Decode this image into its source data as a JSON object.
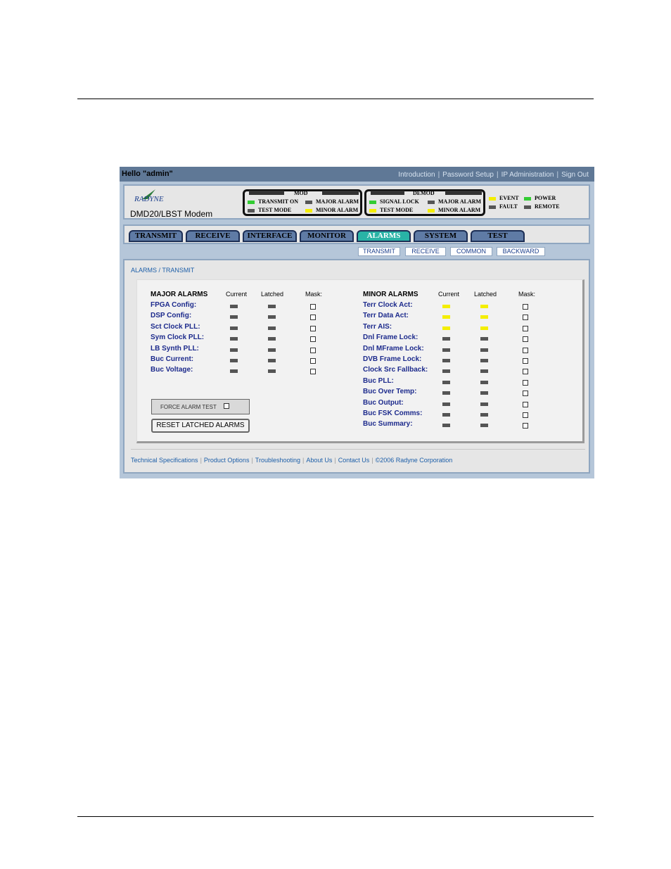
{
  "topbar": {
    "greeting": "Hello \"admin\"",
    "links": [
      "Introduction",
      "Password Setup",
      "IP Administration",
      "Sign Out"
    ]
  },
  "header": {
    "brand": "RADYNE",
    "model": "DMD20/LBST Modem",
    "mod": {
      "title": "MOD",
      "leds": [
        {
          "label": "TRANSMIT ON",
          "color": "#33cc33"
        },
        {
          "label": "TEST MODE",
          "color": "#555555"
        },
        {
          "label": "MAJOR ALARM",
          "color": "#555555"
        },
        {
          "label": "MINOR ALARM",
          "color": "#f4ee00"
        }
      ]
    },
    "demod": {
      "title": "DEMOD",
      "leds": [
        {
          "label": "SIGNAL LOCK",
          "color": "#33cc33"
        },
        {
          "label": "TEST MODE",
          "color": "#f4ee00"
        },
        {
          "label": "MAJOR ALARM",
          "color": "#555555"
        },
        {
          "label": "MINOR ALARM",
          "color": "#f4ee00"
        }
      ]
    },
    "status": [
      {
        "label": "EVENT",
        "color": "#f4ee00"
      },
      {
        "label": "FAULT",
        "color": "#555555"
      },
      {
        "label": "POWER",
        "color": "#33cc33"
      },
      {
        "label": "REMOTE",
        "color": "#555555"
      }
    ]
  },
  "tabs": [
    "TRANSMIT",
    "RECEIVE",
    "INTERFACE",
    "MONITOR",
    "ALARMS",
    "SYSTEM",
    "TEST"
  ],
  "active_tab": "ALARMS",
  "subtabs": [
    "TRANSMIT",
    "RECEIVE",
    "COMMON",
    "BACKWARD"
  ],
  "breadcrumb": "ALARMS / TRANSMIT",
  "major": {
    "title": "MAJOR ALARMS",
    "col_current": "Current",
    "col_latched": "Latched",
    "col_mask": "Mask:",
    "items": [
      {
        "label": "FPGA Config:",
        "current": "#555555",
        "latched": "#555555"
      },
      {
        "label": "DSP Config:",
        "current": "#555555",
        "latched": "#555555"
      },
      {
        "label": "Sct Clock PLL:",
        "current": "#555555",
        "latched": "#555555"
      },
      {
        "label": "Sym Clock PLL:",
        "current": "#555555",
        "latched": "#555555"
      },
      {
        "label": "LB Synth PLL:",
        "current": "#555555",
        "latched": "#555555"
      },
      {
        "label": "Buc Current:",
        "current": "#555555",
        "latched": "#555555"
      },
      {
        "label": "Buc Voltage:",
        "current": "#555555",
        "latched": "#555555"
      }
    ]
  },
  "minor": {
    "title": "MINOR ALARMS",
    "col_current": "Current",
    "col_latched": "Latched",
    "col_mask": "Mask:",
    "items": [
      {
        "label": "Terr Clock Act:",
        "current": "#f4ee00",
        "latched": "#f4ee00"
      },
      {
        "label": "Terr Data Act:",
        "current": "#f4ee00",
        "latched": "#f4ee00"
      },
      {
        "label": "Terr AIS:",
        "current": "#f4ee00",
        "latched": "#f4ee00"
      },
      {
        "label": "Dnl Frame Lock:",
        "current": "#555555",
        "latched": "#555555"
      },
      {
        "label": "Dnl MFrame Lock:",
        "current": "#555555",
        "latched": "#555555"
      },
      {
        "label": "DVB Frame Lock:",
        "current": "#555555",
        "latched": "#555555"
      },
      {
        "label": "Clock Src Fallback:",
        "current": "#555555",
        "latched": "#555555"
      },
      {
        "label": "Buc PLL:",
        "current": "#555555",
        "latched": "#555555"
      },
      {
        "label": "Buc Over Temp:",
        "current": "#555555",
        "latched": "#555555"
      },
      {
        "label": "Buc Output:",
        "current": "#555555",
        "latched": "#555555"
      },
      {
        "label": "Buc FSK Comms:",
        "current": "#555555",
        "latched": "#555555"
      },
      {
        "label": "Buc Summary:",
        "current": "#555555",
        "latched": "#555555"
      }
    ]
  },
  "buttons": {
    "force_alarm_test": "FORCE ALARM TEST",
    "reset_latched": "RESET LATCHED ALARMS"
  },
  "footer": [
    "Technical Specifications",
    "Product Options",
    "Troubleshooting",
    "About Us",
    "Contact Us",
    "©2006 Radyne Corporation"
  ]
}
